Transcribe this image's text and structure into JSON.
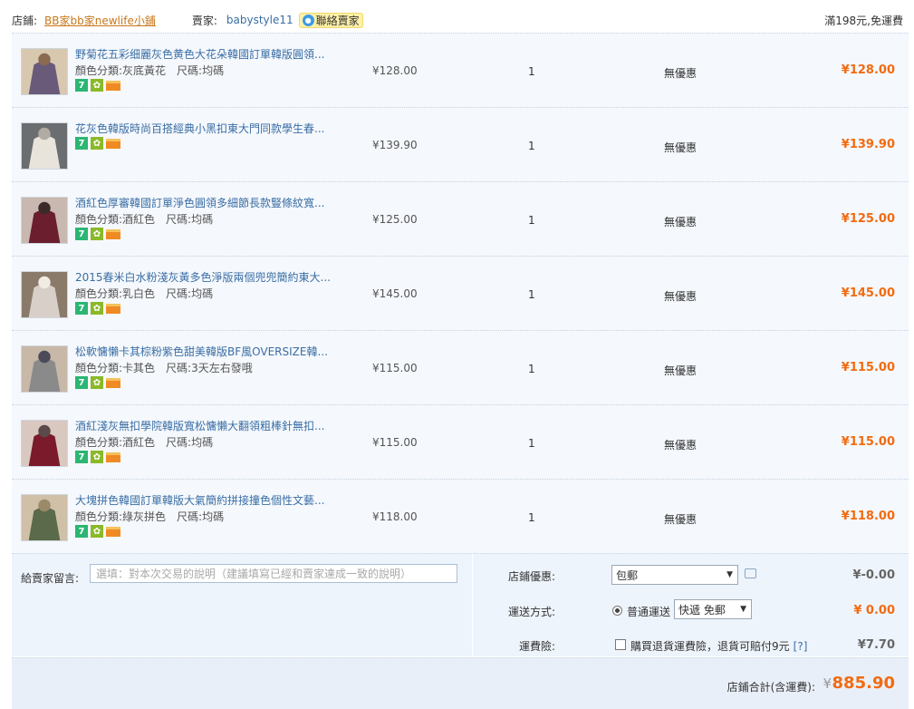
{
  "shop": {
    "shop_label": "店鋪:",
    "shop_name": "BB家bb家newlife小鋪",
    "seller_label": "賣家:",
    "seller_name": "babystyle11",
    "contact_label": "聯絡賣家",
    "free_shipping_note": "滿198元,免運費"
  },
  "currency_symbol": "¥",
  "items": [
    {
      "title": "野菊花五彩细麗灰色黄色大花朵韓國訂單韓版圓領...",
      "attr_color": "顏色分類:灰底黃花",
      "attr_size": "尺碼:均碼",
      "price": "¥128.00",
      "qty": "1",
      "discount": "無優惠",
      "subtotal": "¥128.00",
      "has_attr": true
    },
    {
      "title": "花灰色韓版時尚百搭經典小黑扣東大門同款學生春...",
      "attr_color": "",
      "attr_size": "",
      "price": "¥139.90",
      "qty": "1",
      "discount": "無優惠",
      "subtotal": "¥139.90",
      "has_attr": false
    },
    {
      "title": "酒紅色厚審韓國訂單淨色圓領多細節長款豎條紋寬...",
      "attr_color": "顏色分類:酒紅色",
      "attr_size": "尺碼:均碼",
      "price": "¥125.00",
      "qty": "1",
      "discount": "無優惠",
      "subtotal": "¥125.00",
      "has_attr": true
    },
    {
      "title": "2015春米白水粉淺灰黃多色淨版兩個兜兜簡約東大...",
      "attr_color": "顏色分類:乳白色",
      "attr_size": "尺碼:均碼",
      "price": "¥145.00",
      "qty": "1",
      "discount": "無優惠",
      "subtotal": "¥145.00",
      "has_attr": true
    },
    {
      "title": "松軟慵懶卡其棕粉紫色甜美韓版BF風OVERSIZE韓...",
      "attr_color": "顏色分類:卡其色",
      "attr_size": "尺碼:3天左右發哦",
      "price": "¥115.00",
      "qty": "1",
      "discount": "無優惠",
      "subtotal": "¥115.00",
      "has_attr": true
    },
    {
      "title": "酒紅淺灰無扣學院韓版寬松慵懶大翻領粗棒針無扣...",
      "attr_color": "顏色分類:酒紅色",
      "attr_size": "尺碼:均碼",
      "price": "¥115.00",
      "qty": "1",
      "discount": "無優惠",
      "subtotal": "¥115.00",
      "has_attr": true
    },
    {
      "title": "大塊拼色韓國訂單韓版大氣簡約拼接撞色個性文藝...",
      "attr_color": "顏色分類:綠灰拼色",
      "attr_size": "尺碼:均碼",
      "price": "¥118.00",
      "qty": "1",
      "discount": "無優惠",
      "subtotal": "¥118.00",
      "has_attr": true
    }
  ],
  "message": {
    "label": "給賣家留言:",
    "placeholder": "選填：對本次交易的說明（建議填寫已經和賣家達成一致的說明）"
  },
  "shop_discount": {
    "label": "店鋪優惠:",
    "selected": "包郵",
    "amount": "¥-0.00"
  },
  "shipping": {
    "label": "運送方式:",
    "option_label": "普通運送",
    "selected": "快遞 免郵",
    "amount": "¥ 0.00"
  },
  "insurance": {
    "label": "運費險:",
    "checkbox_label": "購買退貨運費險，退貨可賠付9元",
    "help": "[?]",
    "amount": "¥7.70"
  },
  "total": {
    "label": "店鋪合計(含運費):",
    "yen": "¥",
    "amount": "885.90"
  },
  "colors": {
    "accent_orange": "#f26b11",
    "link_blue": "#3a6ea5",
    "row_bg": "#f5f8fc"
  }
}
